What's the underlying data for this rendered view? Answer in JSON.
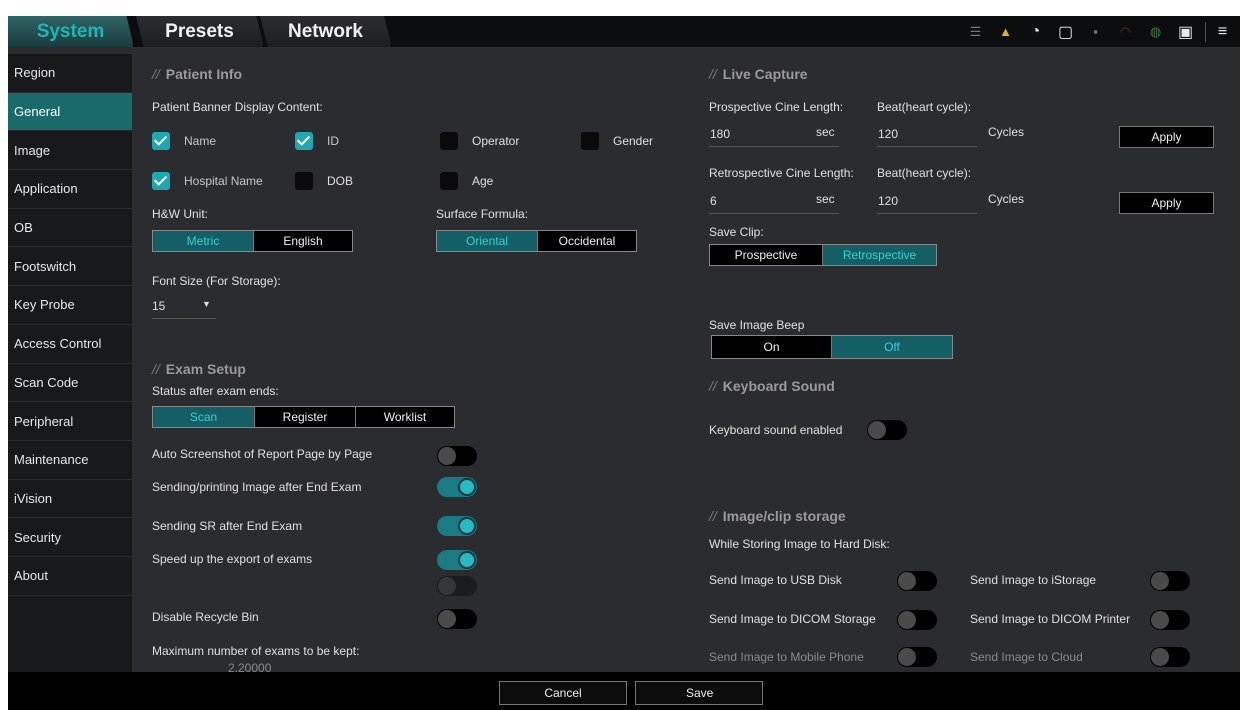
{
  "tabs": [
    "System",
    "Presets",
    "Network"
  ],
  "sidebar": {
    "items": [
      "Region",
      "General",
      "Image",
      "Application",
      "OB",
      "Footswitch",
      "Key Probe",
      "Access Control",
      "Scan Code",
      "Peripheral",
      "Maintenance",
      "iVision",
      "Security",
      "About"
    ],
    "active": "General"
  },
  "patient_info": {
    "title": "Patient Info",
    "banner_label": "Patient Banner Display Content:",
    "name": "Name",
    "id": "ID",
    "operator": "Operator",
    "gender": "Gender",
    "hospital_name": "Hospital Name",
    "dob": "DOB",
    "age": "Age",
    "hw_unit_label": "H&W Unit:",
    "hw_options": [
      "Metric",
      "English"
    ],
    "hw_selected": "Metric",
    "surface_label": "Surface Formula:",
    "surface_options": [
      "Oriental",
      "Occidental"
    ],
    "surface_selected": "Oriental",
    "font_size_label": "Font Size (For Storage):",
    "font_size_value": "15"
  },
  "exam_setup": {
    "title": "Exam Setup",
    "status_label": "Status after exam ends:",
    "status_options": [
      "Scan",
      "Register",
      "Worklist"
    ],
    "status_selected": "Scan",
    "auto_screenshot": "Auto Screenshot of Report Page by Page",
    "sending_printing": "Sending/printing Image after End Exam",
    "sending_sr": "Sending SR after End Exam",
    "speed_export": "Speed up the export of exams",
    "disable_recycle": "Disable Recycle Bin",
    "max_exams_label": "Maximum number of exams to be kept:",
    "max_exams_value": "2,20000"
  },
  "live_capture": {
    "title": "Live Capture",
    "prospective_label": "Prospective Cine Length:",
    "beat_label": "Beat(heart cycle):",
    "prospective_value": "180",
    "sec": "sec",
    "prospective_beat": "120",
    "cycles": "Cycles",
    "apply": "Apply",
    "retro_label": "Retrospective Cine Length:",
    "retro_beat_label": "Beat(heart cycle):",
    "retro_value": "6",
    "retro_beat": "120",
    "save_clip_label": "Save Clip:",
    "save_clip_options": [
      "Prospective",
      "Retrospective"
    ],
    "save_clip_selected": "Retrospective",
    "save_beep_label": "Save Image Beep",
    "beep_options": [
      "On",
      "Off"
    ],
    "beep_selected": "Off"
  },
  "keyboard_sound": {
    "title": "Keyboard Sound",
    "label": "Keyboard sound enabled"
  },
  "storage": {
    "title": "Image/clip storage",
    "while_label": "While Storing Image to Hard Disk:",
    "usb": "Send Image to USB Disk",
    "istorage": "Send Image to iStorage",
    "dicom_storage": "Send Image to DICOM Storage",
    "dicom_printer": "Send Image to DICOM Printer",
    "mobile": "Send Image to Mobile Phone",
    "cloud": "Send Image to Cloud"
  },
  "footer": {
    "cancel": "Cancel",
    "save": "Save"
  },
  "status_icons": [
    "menu-lines-icon",
    "warning-icon",
    "disc-icon",
    "mouse-icon",
    "network-icon",
    "wifi-icon",
    "globe-icon",
    "storage-icon",
    "list-icon"
  ]
}
